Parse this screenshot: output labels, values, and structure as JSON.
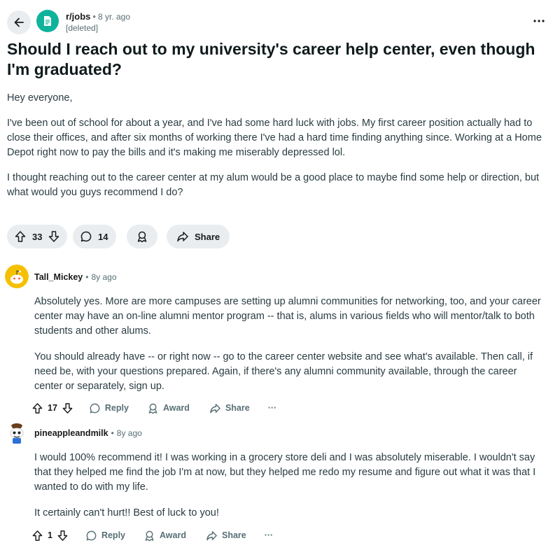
{
  "post": {
    "subreddit": "r/jobs",
    "age": "8 yr. ago",
    "author": "[deleted]",
    "title": "Should I reach out to my university's career help center, even though I'm graduated?",
    "paragraphs": [
      "Hey everyone,",
      "I've been out of school for about a year, and I've had some hard luck with jobs. My first career position actually had to close their offices, and after six months of working there I've had a hard time finding anything since. Working at a Home Depot right now to pay the bills and it's making me miserably depressed lol.",
      "I thought reaching out to the career center at my alum would be a good place to maybe find some help or direction, but what would you guys recommend I do?"
    ],
    "votes": "33",
    "comments": "14",
    "share_label": "Share"
  },
  "comments": [
    {
      "username": "Tall_Mickey",
      "age": "8y ago",
      "paragraphs": [
        "Absolutely yes. More are more campuses are setting up alumni communities for networking, too, and your career center may have an on-line alumni mentor program -- that is, alums in various fields who will mentor/talk to both students and other alums.",
        "You should already have -- or right now -- go to the career center website and see what's available. Then call, if need be, with your questions prepared. Again, if there's any alumni community available, through the career center or separately, sign up."
      ],
      "votes": "17",
      "reply_label": "Reply",
      "award_label": "Award",
      "share_label": "Share",
      "more_label": "···"
    },
    {
      "username": "pineappleandmilk",
      "age": "8y ago",
      "paragraphs": [
        "I would 100% recommend it! I was working in a grocery store deli and I was absolutely miserable. I wouldn't say that they helped me find the job I'm at now, but they helped me redo my resume and figure out what it was that I wanted to do with my life.",
        "It certainly can't hurt!! Best of luck to you!"
      ],
      "votes": "1",
      "reply_label": "Reply",
      "award_label": "Award",
      "share_label": "Share",
      "more_label": "···"
    }
  ],
  "colors": {
    "subreddit_icon": "#0fb39c",
    "pill_bg": "#eaedef",
    "meta_text": "#576f76",
    "snoo_avatar": "#f5c000"
  },
  "icons": {
    "back": "arrow-left-icon",
    "more": "ellipsis-icon",
    "upvote": "arrow-up-icon",
    "downvote": "arrow-down-icon",
    "comment": "speech-bubble-icon",
    "award": "award-icon",
    "share": "share-arrow-icon"
  }
}
